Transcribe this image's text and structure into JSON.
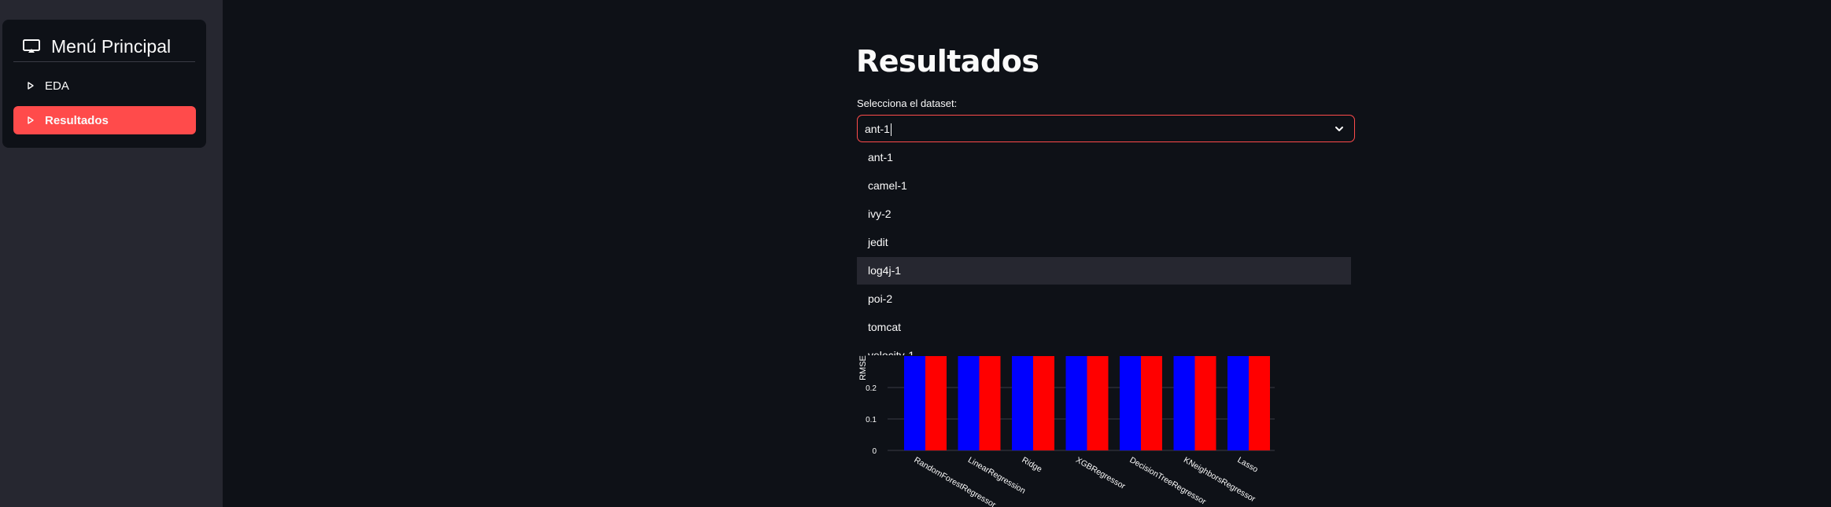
{
  "sidebar": {
    "title": "Menú Principal",
    "items": [
      {
        "label": "EDA",
        "active": false
      },
      {
        "label": "Resultados",
        "active": true
      }
    ]
  },
  "main": {
    "title": "Resultados",
    "select": {
      "label": "Selecciona el dataset:",
      "value": "ant-1",
      "options": [
        "ant-1",
        "camel-1",
        "ivy-2",
        "jedit",
        "log4j-1",
        "poi-2",
        "tomcat",
        "velocity-1"
      ],
      "highlighted": "log4j-1"
    }
  },
  "colors": {
    "accent": "#ff4b4b",
    "series_blue": "#0000ff",
    "series_red": "#ff0000"
  },
  "chart_data": {
    "type": "bar",
    "ylabel": "RMSE",
    "categories": [
      "RandomForestRegressor",
      "LinearRegression",
      "Ridge",
      "XGBRegressor",
      "DecisionTreeRegressor",
      "KNeighborsRegressor",
      "Lasso"
    ],
    "yticks": [
      "0",
      "0.1",
      "0.2"
    ],
    "series": [
      {
        "color": "#0000ff",
        "values": [
          0.3,
          0.3,
          0.3,
          0.3,
          0.3,
          0.3,
          0.3
        ]
      },
      {
        "color": "#ff0000",
        "values": [
          0.3,
          0.3,
          0.3,
          0.3,
          0.3,
          0.3,
          0.3
        ]
      }
    ]
  }
}
